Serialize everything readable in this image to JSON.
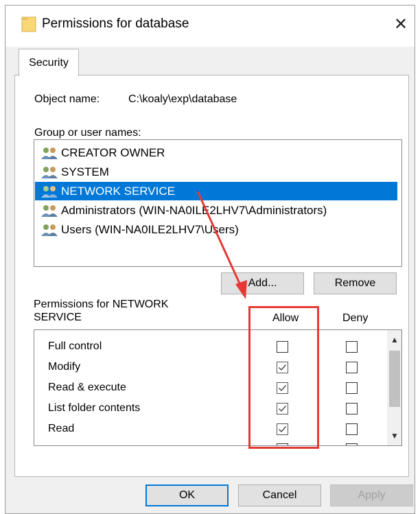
{
  "window": {
    "title": "Permissions for database",
    "close_glyph": "✕"
  },
  "tabs": [
    {
      "label": "Security",
      "selected": true
    }
  ],
  "object_name": {
    "label": "Object name:",
    "value": "C:\\koaly\\exp\\database"
  },
  "group_section": {
    "label": "Group or user names:"
  },
  "users": [
    {
      "name": "CREATOR OWNER",
      "icon": "users-icon",
      "selected": false
    },
    {
      "name": "SYSTEM",
      "icon": "users-icon",
      "selected": false
    },
    {
      "name": "NETWORK SERVICE",
      "icon": "users-icon",
      "selected": true
    },
    {
      "name": "Administrators (WIN-NA0ILE2LHV7\\Administrators)",
      "icon": "users-icon",
      "selected": false
    },
    {
      "name": "Users (WIN-NA0ILE2LHV7\\Users)",
      "icon": "users-icon",
      "selected": false
    }
  ],
  "user_buttons": {
    "add": "Add...",
    "remove": "Remove"
  },
  "permissions": {
    "title_line1": "Permissions for NETWORK",
    "title_line2": "SERVICE",
    "allow_header": "Allow",
    "deny_header": "Deny",
    "rows": [
      {
        "name": "Full control",
        "allow": false,
        "deny": false
      },
      {
        "name": "Modify",
        "allow": true,
        "deny": false
      },
      {
        "name": "Read & execute",
        "allow": true,
        "deny": false
      },
      {
        "name": "List folder contents",
        "allow": true,
        "deny": false
      },
      {
        "name": "Read",
        "allow": true,
        "deny": false
      }
    ]
  },
  "footer": {
    "ok": "OK",
    "cancel": "Cancel",
    "apply": "Apply"
  },
  "colors": {
    "selection": "#0078d7",
    "annotation": "#e53935",
    "dialog_bg": "#f0f0f0"
  }
}
